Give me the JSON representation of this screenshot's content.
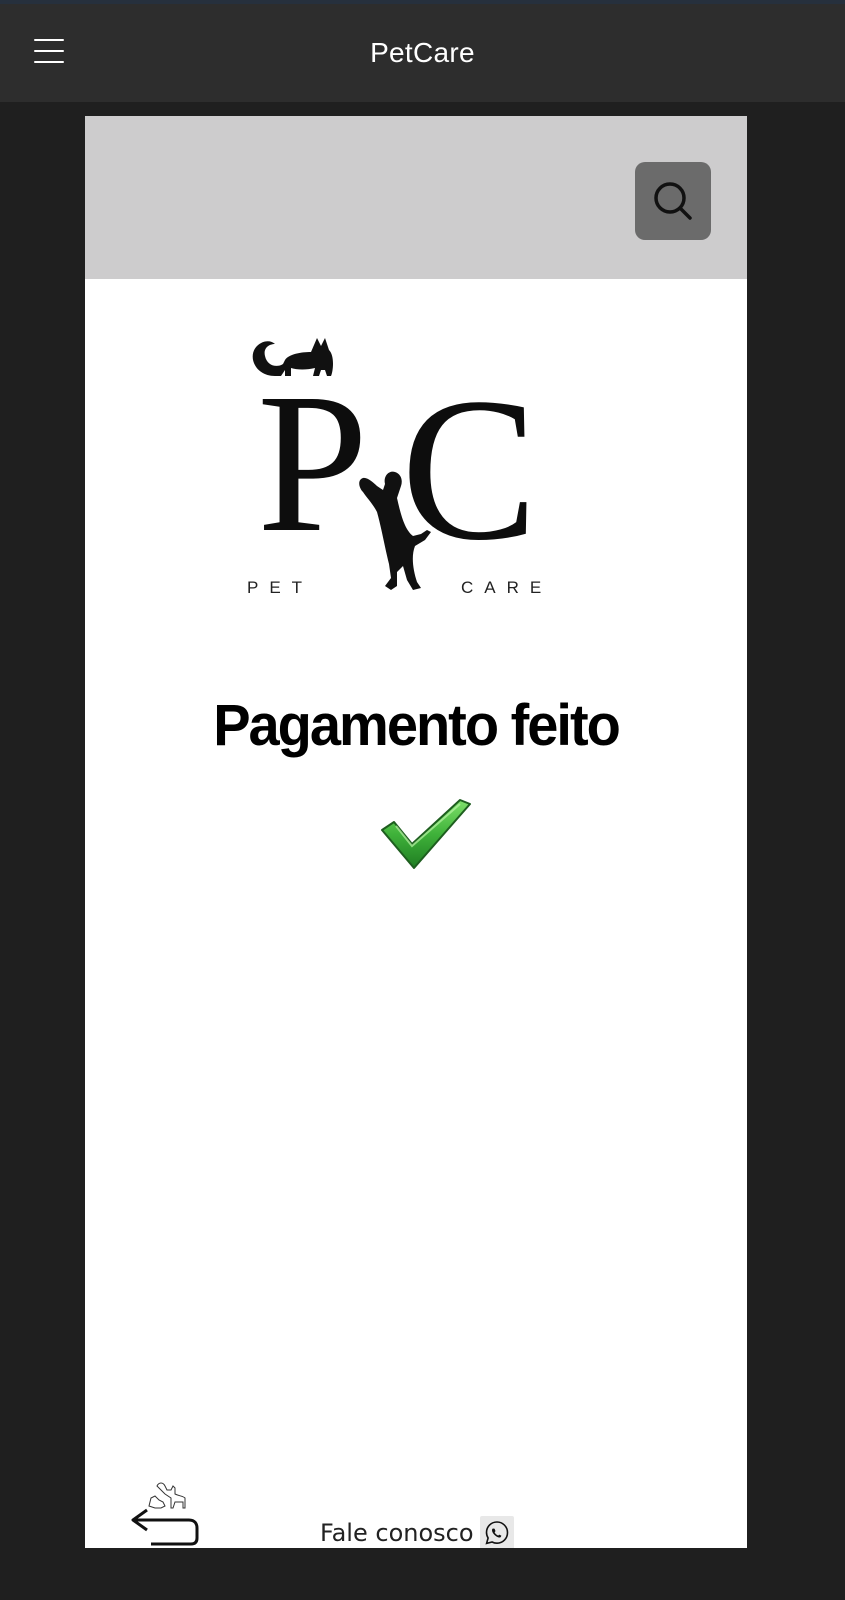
{
  "app": {
    "title": "PetCare"
  },
  "icons": {
    "menu": "hamburger-menu-icon",
    "search": "search-icon",
    "success": "checkmark-icon",
    "back": "return-arrow-icon",
    "whatsapp": "whatsapp-icon"
  },
  "logo": {
    "initials": "PC",
    "word_left": "PET",
    "word_right": "CARE"
  },
  "status": {
    "heading": "Pagamento feito"
  },
  "footer": {
    "contact_label": "Fale conosco"
  },
  "colors": {
    "appbar": "#2d2d2d",
    "background": "#1f1f1f",
    "header_band": "#cdcccd",
    "search_button": "#6b6b6b",
    "success_green": "#3fb23a"
  }
}
